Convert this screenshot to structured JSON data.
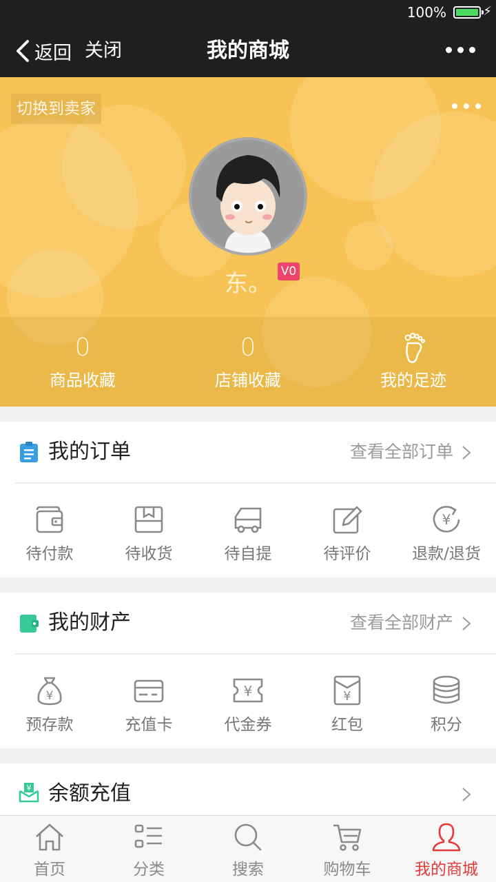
{
  "status_bar": {
    "battery": "100%",
    "colors": {
      "battery_fill": "#4cd964"
    }
  },
  "nav": {
    "back_label": "返回",
    "close_label": "关闭",
    "title": "我的商城"
  },
  "profile": {
    "switch_label": "切换到卖家",
    "username": "东。",
    "level": "V0",
    "stats": [
      {
        "value": "0",
        "label": "商品收藏"
      },
      {
        "value": "0",
        "label": "店铺收藏"
      },
      {
        "icon": "footprint-icon",
        "label": "我的足迹"
      }
    ],
    "colors": {
      "header_bg": "#f7c354",
      "badge": "#f0446b"
    }
  },
  "orders": {
    "title": "我的订单",
    "link": "查看全部订单",
    "items": [
      {
        "icon": "wallet-icon",
        "label": "待付款"
      },
      {
        "icon": "package-icon",
        "label": "待收货"
      },
      {
        "icon": "truck-icon",
        "label": "待自提"
      },
      {
        "icon": "edit-review-icon",
        "label": "待评价"
      },
      {
        "icon": "refund-icon",
        "label": "退款/退货"
      }
    ]
  },
  "assets": {
    "title": "我的财产",
    "link": "查看全部财产",
    "items": [
      {
        "icon": "money-bag-icon",
        "label": "预存款"
      },
      {
        "icon": "card-icon",
        "label": "充值卡"
      },
      {
        "icon": "voucher-icon",
        "label": "代金券"
      },
      {
        "icon": "red-envelope-icon",
        "label": "红包"
      },
      {
        "icon": "coins-icon",
        "label": "积分"
      }
    ]
  },
  "recharge": {
    "title": "余额充值"
  },
  "tabbar": {
    "active_color": "#e43a3a",
    "items": [
      {
        "icon": "home-icon",
        "label": "首页"
      },
      {
        "icon": "category-icon",
        "label": "分类"
      },
      {
        "icon": "search-icon",
        "label": "搜索"
      },
      {
        "icon": "cart-icon",
        "label": "购物车"
      },
      {
        "icon": "user-icon",
        "label": "我的商城",
        "active": true
      }
    ]
  }
}
